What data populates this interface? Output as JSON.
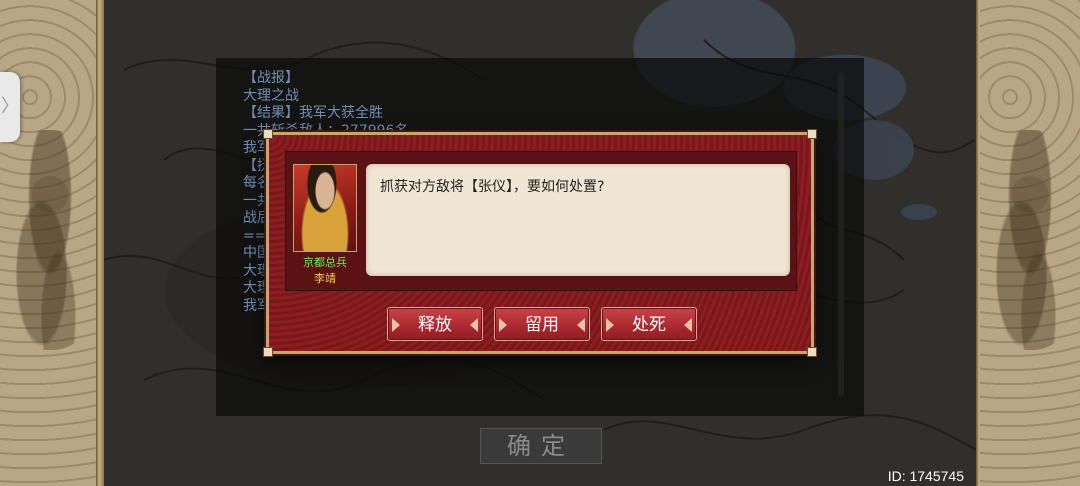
{
  "report": {
    "lines": [
      "【战报】",
      "大理之战",
      "【结果】我军大获全胜",
      "一共斩杀敌人：277996名",
      "我军",
      "【抚",
      "每名",
      "一共",
      "战后",
      "===",
      "中国",
      "大理",
      "大理",
      "我军"
    ]
  },
  "dialog": {
    "message": "抓获对方敌将【张仪】，要如何处置?",
    "general_title": "京都总兵",
    "general_name": "李靖",
    "buttons": [
      "释放",
      "留用",
      "处死"
    ]
  },
  "confirm_label": "确定",
  "id_label": "ID: 1745745",
  "side_tab_glyph": "〉",
  "colors": {
    "dialog_red": "#841b1f",
    "button_red": "#a9282e",
    "gold_border": "#caa574",
    "report_text": "#6f8fb5",
    "title_green": "#6df05b",
    "name_yellow": "#f0d24a"
  }
}
